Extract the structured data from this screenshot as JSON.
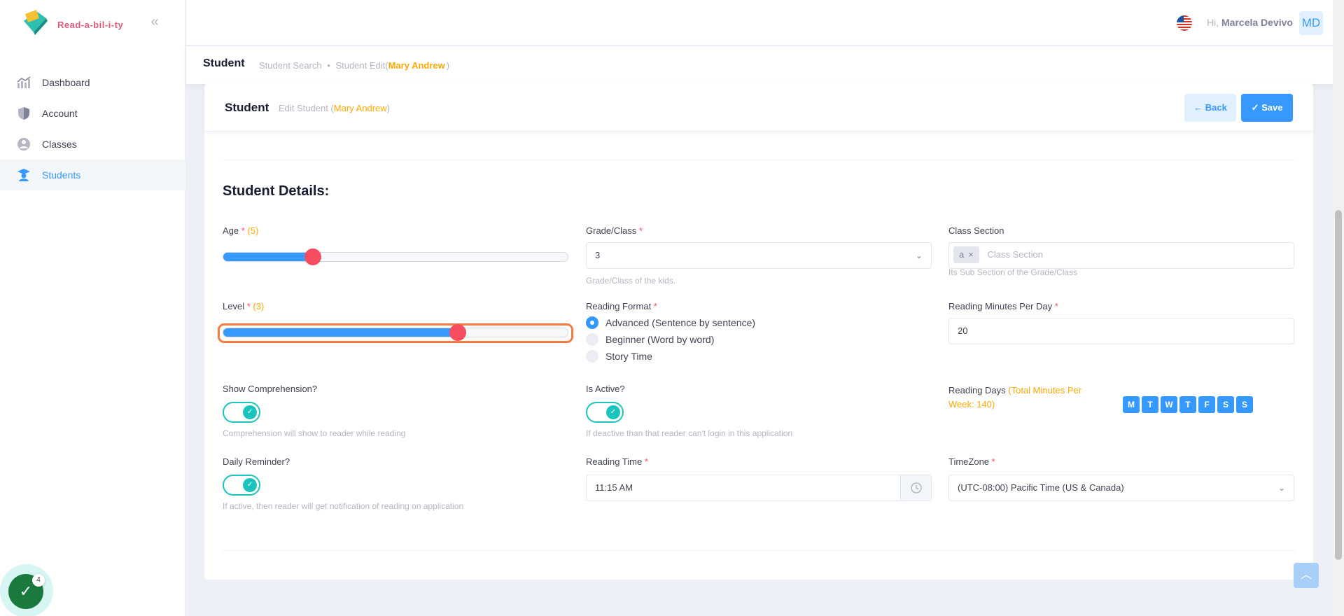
{
  "brand": {
    "name": "Read-a-bil-i-ty"
  },
  "sidebar": {
    "items": [
      {
        "label": "Dashboard",
        "icon": "chart-line-icon"
      },
      {
        "label": "Account",
        "icon": "shield-icon"
      },
      {
        "label": "Classes",
        "icon": "group-icon"
      },
      {
        "label": "Students",
        "icon": "graduate-icon"
      }
    ]
  },
  "header": {
    "greeting_prefix": "Hi,",
    "user_name": "Marcela Devivo",
    "avatar_initials": "MD"
  },
  "subheader": {
    "title": "Student",
    "crumb_1": "Student Search",
    "crumb_sep": "•",
    "crumb_2_prefix": "Student Edit(",
    "crumb_2_name": "Mary Andrew",
    "crumb_2_suffix": ")"
  },
  "card": {
    "title": "Student",
    "subtitle_prefix": "Edit Student (",
    "subtitle_name": "Mary Andrew",
    "subtitle_suffix": ")",
    "back_label": "← Back",
    "save_label": "✓ Save"
  },
  "form": {
    "section_title": "Student Details:",
    "age": {
      "label": "Age",
      "required": "*",
      "value_display": "(5)",
      "fill_percent": 26
    },
    "level": {
      "label": "Level",
      "required": "*",
      "value_display": "(3)",
      "fill_percent": 68
    },
    "grade": {
      "label": "Grade/Class",
      "required": "*",
      "value": "3",
      "hint": "Grade/Class of the kids."
    },
    "class_section": {
      "label": "Class Section",
      "tag": "a",
      "placeholder": "Class Section",
      "hint": "Its Sub Section of the Grade/Class"
    },
    "reading_format": {
      "label": "Reading Format",
      "required": "*",
      "options": [
        "Advanced (Sentence by sentence)",
        "Beginner (Word by word)",
        "Story Time"
      ],
      "selected": "Advanced (Sentence by sentence)"
    },
    "reading_minutes": {
      "label": "Reading Minutes Per Day",
      "required": "*",
      "value": "20"
    },
    "show_comprehension": {
      "label": "Show Comprehension?",
      "on": true,
      "hint": "Comprehension will show to reader while reading"
    },
    "is_active": {
      "label": "Is Active?",
      "on": true,
      "hint": "If deactive than that reader can't login in this application"
    },
    "reading_days": {
      "label": "Reading Days",
      "total_text": "(Total Minutes Per Week: 140)",
      "days": [
        "M",
        "T",
        "W",
        "T",
        "F",
        "S",
        "S"
      ]
    },
    "daily_reminder": {
      "label": "Daily Reminder?",
      "on": true,
      "hint": "If active, then reader will get notification of reading on application"
    },
    "reading_time": {
      "label": "Reading Time",
      "required": "*",
      "value": "11:15 AM"
    },
    "timezone": {
      "label": "TimeZone",
      "required": "*",
      "value": "(UTC-08:00) Pacific Time (US & Canada)"
    }
  },
  "task_widget": {
    "count": "4"
  },
  "colors": {
    "primary": "#3699ff",
    "danger": "#f64e60",
    "warning": "#ffa800",
    "success": "#1bc5bd"
  }
}
